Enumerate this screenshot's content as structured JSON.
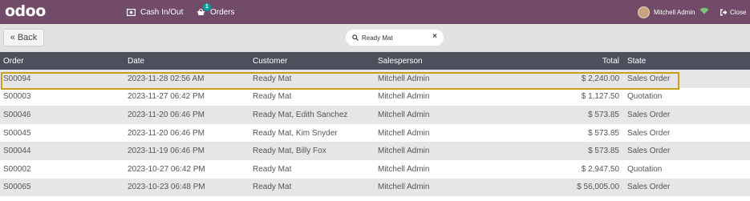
{
  "header": {
    "logo": "odoo",
    "cash_label": "Cash In/Out",
    "orders_label": "Orders",
    "orders_badge": "1",
    "user_name": "Mitchell Admin",
    "close_label": "Close"
  },
  "toolbar": {
    "back_label": "Back",
    "search_value": "Ready Mat"
  },
  "table": {
    "columns": {
      "order": "Order",
      "date": "Date",
      "customer": "Customer",
      "salesperson": "Salesperson",
      "total": "Total",
      "state": "State"
    },
    "rows": [
      {
        "order": "S00094",
        "date": "2023-11-28 02:56 AM",
        "customer": "Ready Mat",
        "salesperson": "Mitchell Admin",
        "total": "$ 2,240.00",
        "state": "Sales Order"
      },
      {
        "order": "S00003",
        "date": "2023-11-27 06:42 PM",
        "customer": "Ready Mat",
        "salesperson": "Mitchell Admin",
        "total": "$ 1,127.50",
        "state": "Quotation"
      },
      {
        "order": "S00046",
        "date": "2023-11-20 06:46 PM",
        "customer": "Ready Mat, Edith Sanchez",
        "salesperson": "Mitchell Admin",
        "total": "$ 573.85",
        "state": "Sales Order"
      },
      {
        "order": "S00045",
        "date": "2023-11-20 06:46 PM",
        "customer": "Ready Mat, Kim Snyder",
        "salesperson": "Mitchell Admin",
        "total": "$ 573.85",
        "state": "Sales Order"
      },
      {
        "order": "S00044",
        "date": "2023-11-19 06:46 PM",
        "customer": "Ready Mat, Billy Fox",
        "salesperson": "Mitchell Admin",
        "total": "$ 573.85",
        "state": "Sales Order"
      },
      {
        "order": "S00002",
        "date": "2023-10-27 06:42 PM",
        "customer": "Ready Mat",
        "salesperson": "Mitchell Admin",
        "total": "$ 2,947.50",
        "state": "Quotation"
      },
      {
        "order": "S00065",
        "date": "2023-10-23 06:48 PM",
        "customer": "Ready Mat",
        "salesperson": "Mitchell Admin",
        "total": "$ 56,005.00",
        "state": "Sales Order"
      }
    ]
  },
  "colors": {
    "topbar": "#714b67",
    "table_header": "#4b505c",
    "row_highlight": "#c9a01e",
    "badge": "#00a09d"
  }
}
